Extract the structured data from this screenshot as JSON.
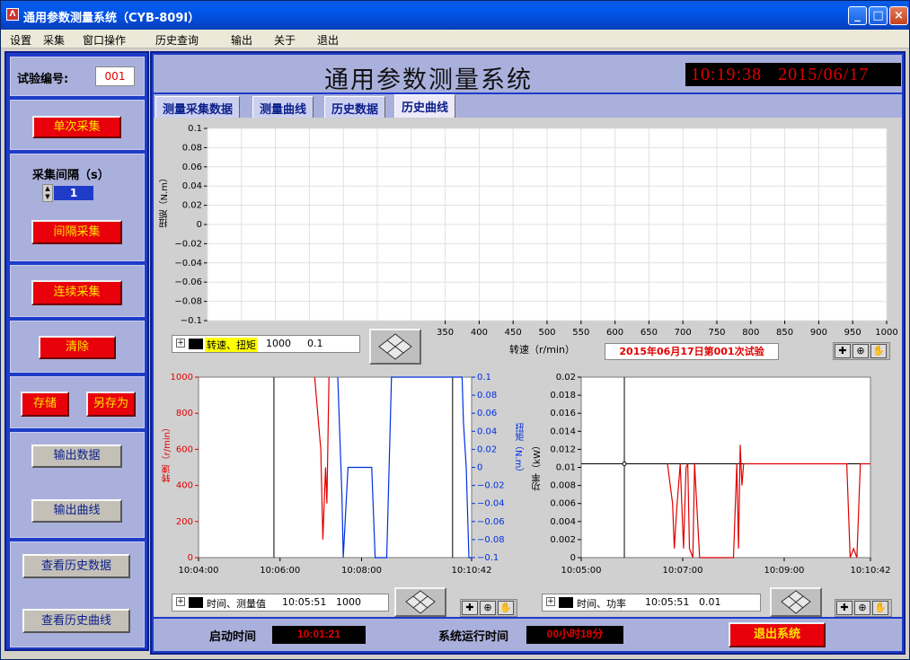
{
  "window": {
    "title": "通用参数测量系统（CYB-809I）",
    "controls": [
      "_",
      "□",
      "×"
    ]
  },
  "menu": [
    "设置",
    "采集",
    "窗口操作",
    "历史查询",
    "输出",
    "关于",
    "退出"
  ],
  "left": {
    "test_no_label": "试验编号:",
    "test_no_value": "001",
    "single_btn": "单次采集",
    "interval_label": "采集间隔（s）",
    "interval_value": "1",
    "interval_btn": "间隔采集",
    "continuous_btn": "连续采集",
    "clear_btn": "清除",
    "save_btn": "存储",
    "saveas_btn": "另存为",
    "export_data_btn": "输出数据",
    "export_curve_btn": "输出曲线",
    "view_hist_data_btn": "查看历史数据",
    "view_hist_curve_btn": "查看历史曲线"
  },
  "header": {
    "title": "通用参数测量系统",
    "time": "10:19:38",
    "date": "2015/06/17"
  },
  "tabs": [
    "测量采集数据",
    "测量曲线",
    "历史数据",
    "历史曲线"
  ],
  "selected_tab": 3,
  "top_plot": {
    "ylabel": "扭矩（N.m）",
    "xlabel": "转速（r/min）",
    "record_label": "2015年06月17日第001次试验",
    "legend": {
      "name": "转速、扭矩",
      "v1": "1000",
      "v2": "0.1"
    }
  },
  "left_plot": {
    "ylabel_left": "转速（r/min）",
    "ylabel_right": "扭矩（N.m）",
    "legend": {
      "name": "时间、测量值",
      "v1": "10:05:51",
      "v2": "1000"
    }
  },
  "right_plot": {
    "ylabel": "功率（kW）",
    "legend": {
      "name": "时间、功率",
      "v1": "10:05:51",
      "v2": "0.01"
    }
  },
  "footer": {
    "start_label": "启动时间",
    "start_value": "10:01:21",
    "run_label": "系统运行时间",
    "run_value": "00小时18分",
    "exit_btn": "退出系统"
  },
  "colors": {
    "accent": "#e8000a",
    "frame": "#1e3cc8",
    "panel": "#aab0dc",
    "speed": "#e00000",
    "torque": "#0030e0"
  },
  "chart_data": [
    {
      "type": "line",
      "title": "",
      "xlabel": "转速（r/min）",
      "ylabel": "扭矩（N.m）",
      "xlim": [
        0,
        1000
      ],
      "ylim": [
        -0.1,
        0.1
      ],
      "x_ticks": [
        "350",
        "400",
        "450",
        "500",
        "550",
        "600",
        "650",
        "700",
        "750",
        "800",
        "850",
        "900",
        "950",
        "1000"
      ],
      "y_ticks": [
        "0.1",
        "0.08",
        "0.06",
        "0.04",
        "0.02",
        "0",
        "-0.02",
        "-0.04",
        "-0.06",
        "-0.08",
        "-0.1"
      ],
      "series": [],
      "grid": true
    },
    {
      "type": "line",
      "xlabel": "",
      "ylabel": "转速（r/min）",
      "ylabel_right": "扭矩（N.m）",
      "x_ticks": [
        "10:04:00",
        "10:06:00",
        "10:08:00",
        "10:10:42"
      ],
      "y_ticks": [
        "1000",
        "800",
        "600",
        "400",
        "200",
        "0"
      ],
      "y2_ticks": [
        "0.1",
        "0.08",
        "0.06",
        "0.04",
        "0.02",
        "0",
        "-0.02",
        "-0.04",
        "-0.06",
        "-0.08",
        "-0.1"
      ],
      "xlim": [
        "10:04:00",
        "10:10:42"
      ],
      "ylim": [
        0,
        1000
      ],
      "y2lim": [
        -0.1,
        0.1
      ],
      "cursor_x": [
        "10:05:51",
        "10:10:14"
      ],
      "series": [
        {
          "color": "#e00000",
          "axis": "left",
          "x": [
            "10:06:51",
            "10:07:00",
            "10:07:03",
            "10:07:07",
            "10:07:09",
            "10:07:12"
          ],
          "y": [
            1000,
            600,
            100,
            500,
            300,
            1000
          ]
        },
        {
          "color": "#0030e0",
          "axis": "right",
          "x": [
            "10:07:25",
            "10:07:31",
            "10:07:33",
            "10:07:40",
            "10:08:15",
            "10:08:20",
            "10:08:37",
            "10:08:44",
            "10:10:28",
            "10:10:30",
            "10:10:34",
            "10:10:38",
            "10:10:42"
          ],
          "y": [
            0.1,
            -0.03,
            -0.1,
            0,
            0,
            -0.1,
            -0.1,
            0.1,
            0.1,
            0.05,
            0,
            -0.1,
            -0.1
          ]
        }
      ]
    },
    {
      "type": "line",
      "xlabel": "",
      "ylabel": "功率（kW）",
      "x_ticks": [
        "10:05:00",
        "10:07:00",
        "10:09:00",
        "10:10:42"
      ],
      "y_ticks": [
        "0.02",
        "0.018",
        "0.016",
        "0.014",
        "0.012",
        "0.01",
        "0.008",
        "0.006",
        "0.004",
        "0.002",
        "0"
      ],
      "xlim": [
        "10:05:00",
        "10:10:42"
      ],
      "ylim": [
        0,
        0.02
      ],
      "cursor": {
        "x": "10:05:51",
        "y": 0.0104
      },
      "series": [
        {
          "color": "#e00000",
          "x": [
            "10:06:42",
            "10:06:48",
            "10:06:50",
            "10:06:53",
            "10:06:57",
            "10:07:01",
            "10:07:04",
            "10:07:06",
            "10:07:08",
            "10:07:12",
            "10:07:14",
            "10:07:16",
            "10:07:20",
            "10:07:30",
            "10:07:40",
            "10:07:50",
            "10:08:00",
            "10:08:04",
            "10:08:06",
            "10:08:08",
            "10:08:10",
            "10:08:12",
            "10:08:14",
            "10:08:18",
            "10:10:14",
            "10:10:18",
            "10:10:22",
            "10:10:26",
            "10:10:30",
            "10:10:34",
            "10:10:38",
            "10:10:42"
          ],
          "y": [
            0.0104,
            0.006,
            0.001,
            0.0055,
            0.0104,
            0.001,
            0.01,
            0.0104,
            0.001,
            0,
            0.0105,
            0.007,
            0,
            0,
            0,
            0,
            0,
            0.0104,
            0.001,
            0.0125,
            0.008,
            0.0104,
            0.0104,
            0.0104,
            0.0104,
            0,
            0.001,
            0,
            0.0104,
            0.0104,
            0.0104,
            0.0104
          ]
        }
      ]
    }
  ]
}
